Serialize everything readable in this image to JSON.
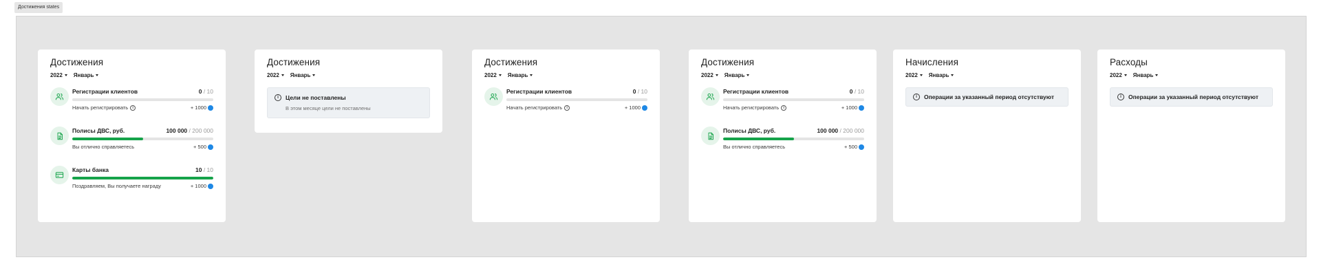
{
  "frame_label": "Достижения states",
  "cards": [
    {
      "title": "Достижения",
      "year": "2022",
      "month": "Январь",
      "achievements": [
        {
          "name": "Регистрации клиентов",
          "current": "0",
          "total": "/ 10",
          "progress": 0,
          "desc": "Начать регистрировать",
          "has_info": true,
          "reward": "+ 1000",
          "icon": "users-icon"
        },
        {
          "name": "Полисы ДВС, руб.",
          "current": "100 000",
          "total": "/ 200 000",
          "progress": 0.5,
          "desc": "Вы отлично справляетесь",
          "has_info": false,
          "reward": "+ 500",
          "icon": "document-icon"
        },
        {
          "name": "Карты банка",
          "current": "10",
          "total": "/ 10",
          "progress": 1.0,
          "desc": "Поздравляем, Вы получаете награду",
          "has_info": false,
          "reward": "+ 1000",
          "icon": "credit-card-icon"
        }
      ]
    },
    {
      "title": "Достижения",
      "year": "2022",
      "month": "Январь",
      "notice": {
        "title": "Цели не поставлены",
        "subtitle": "В этом месяце цели не поставлены"
      }
    },
    {
      "title": "Достижения",
      "year": "2022",
      "month": "Январь",
      "achievements": [
        {
          "name": "Регистрации клиентов",
          "current": "0",
          "total": "/ 10",
          "progress": 0,
          "desc": "Начать регистрировать",
          "has_info": true,
          "reward": "+ 1000",
          "icon": "users-icon"
        }
      ]
    },
    {
      "title": "Достижения",
      "year": "2022",
      "month": "Январь",
      "achievements": [
        {
          "name": "Регистрации клиентов",
          "current": "0",
          "total": "/ 10",
          "progress": 0,
          "desc": "Начать регистрировать",
          "has_info": true,
          "reward": "+ 1000",
          "icon": "users-icon"
        },
        {
          "name": "Полисы ДВС, руб.",
          "current": "100 000",
          "total": "/ 200 000",
          "progress": 0.5,
          "desc": "Вы отлично справляетесь",
          "has_info": false,
          "reward": "+ 500",
          "icon": "document-icon"
        }
      ]
    },
    {
      "title": "Начисления",
      "year": "2022",
      "month": "Январь",
      "notice": {
        "title": "Операции за указанный период отсутствуют"
      }
    },
    {
      "title": "Расходы",
      "year": "2022",
      "month": "Январь",
      "notice": {
        "title": "Операции за указанный период отсутствуют"
      }
    }
  ],
  "colors": {
    "accent": "#16a34a",
    "icon_bg": "#e5f4ea",
    "coin": "#1e88e5",
    "canvas": "#e5e5e5"
  }
}
